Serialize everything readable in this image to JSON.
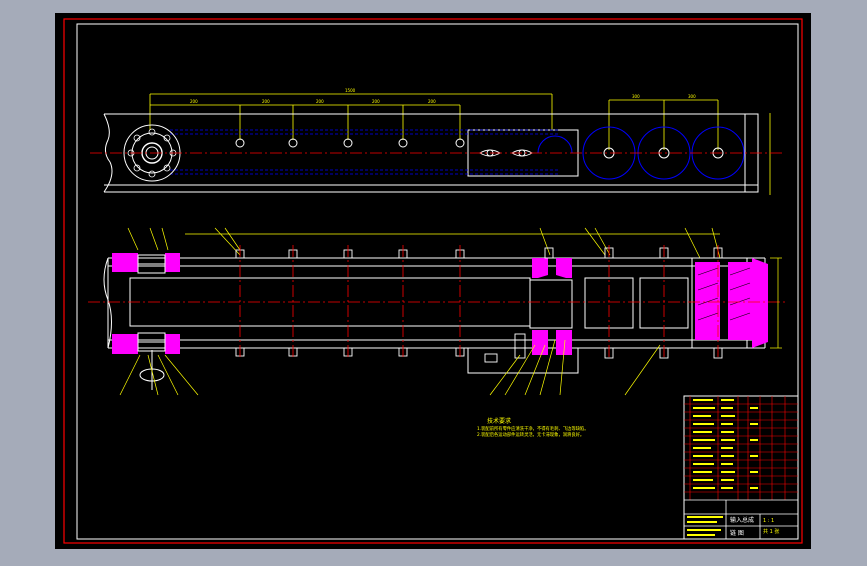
{
  "drawing": {
    "title_block": {
      "drawing_name": "输入总成",
      "part_name": "链 图",
      "scale_text": "1 : 1",
      "sheet_text": "共 1 张"
    },
    "notes": {
      "heading": "技术要求",
      "lines": [
        "1.装配前所有零件应清洗干净，不得有毛刺、飞边等缺陷。",
        "2.装配后各运动部件运转灵活，无卡滞现象，润滑良好。"
      ]
    },
    "colors": {
      "background": "#000000",
      "outer_frame": "#ff0000",
      "geometry": "#ffffff",
      "dimension": "#ffff00",
      "center_line": "#ff0000",
      "hidden_line": "#0000ff",
      "section_fill": "#ff00ff"
    }
  }
}
